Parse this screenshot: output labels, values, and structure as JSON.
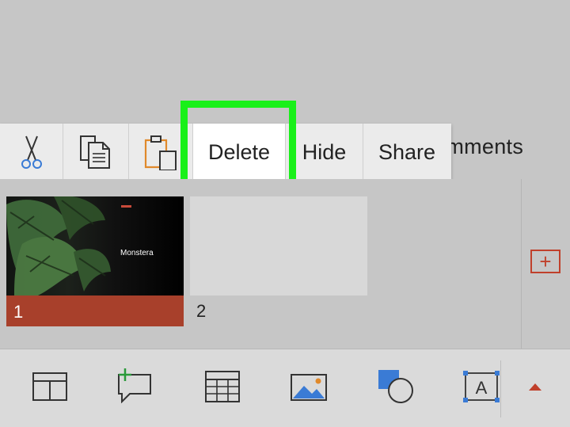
{
  "ribbon": {
    "comments_tab_label": "Comments",
    "comments_tab_visible_text": "omments"
  },
  "context_menu": {
    "items": [
      {
        "id": "cut",
        "icon": "scissors-icon"
      },
      {
        "id": "copy",
        "icon": "copy-icon"
      },
      {
        "id": "paste",
        "icon": "clipboard-icon"
      },
      {
        "id": "delete",
        "label": "Delete"
      },
      {
        "id": "hide",
        "label": "Hide"
      },
      {
        "id": "share",
        "label": "Share"
      }
    ],
    "highlighted": "delete",
    "highlight_color": "#19f019"
  },
  "slides": [
    {
      "number": "1",
      "title": "Monstera",
      "selected": true
    },
    {
      "number": "2",
      "title": "",
      "selected": false
    }
  ],
  "add_slide_icon": "plus-box-icon",
  "bottom_toolbar": {
    "icons": [
      "layout-icon",
      "add-comment-icon",
      "table-icon",
      "picture-icon",
      "shapes-icon",
      "textbox-icon",
      "expand-up-icon"
    ]
  },
  "colors": {
    "accent": "#a8402b",
    "icon_blue": "#3a7bd5",
    "icon_green": "#2a9a3a"
  }
}
